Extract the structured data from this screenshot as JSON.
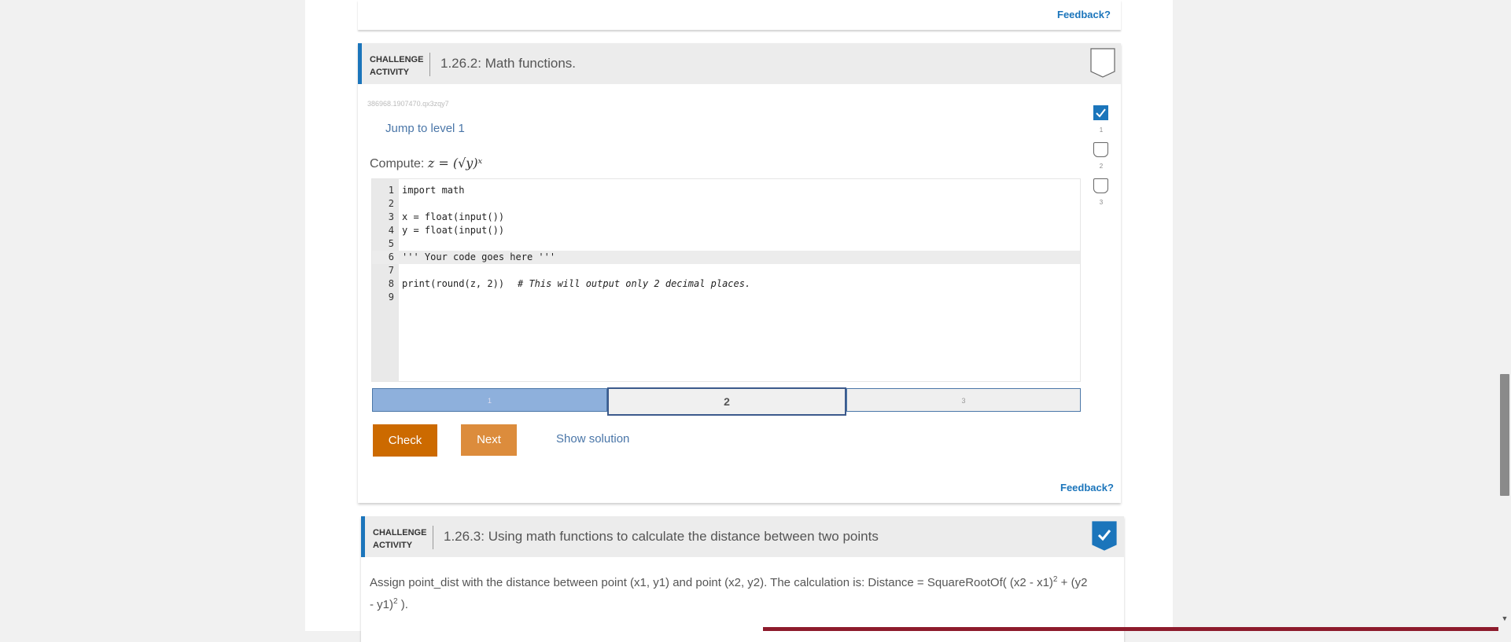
{
  "prev_card": {
    "feedback": "Feedback?"
  },
  "activity": {
    "badge_line1": "CHALLENGE",
    "badge_line2": "ACTIVITY",
    "title": "1.26.2: Math functions.",
    "id": "386968.1907470.qx3zqy7",
    "jump": "Jump to level 1",
    "compute_label": "Compute:",
    "compute_formula": "z = (√y)ˣ",
    "code": [
      {
        "n": "1",
        "t": "import math"
      },
      {
        "n": "2",
        "t": ""
      },
      {
        "n": "3",
        "t": "x = float(input())"
      },
      {
        "n": "4",
        "t": "y = float(input())"
      },
      {
        "n": "5",
        "t": ""
      },
      {
        "n": "6",
        "t": "''' Your code goes here '''"
      },
      {
        "n": "7",
        "t": ""
      },
      {
        "n": "8",
        "t": "print(round(z, 2))",
        "comment": "# This will output only 2 decimal places."
      },
      {
        "n": "9",
        "t": ""
      }
    ],
    "levels": [
      "1",
      "2",
      "3"
    ],
    "current_level": 2,
    "level_checks": [
      {
        "num": "1",
        "checked": true
      },
      {
        "num": "2",
        "checked": false
      },
      {
        "num": "3",
        "checked": false
      }
    ],
    "check_label": "Check",
    "next_label": "Next",
    "show_solution": "Show solution",
    "feedback": "Feedback?"
  },
  "next_activity": {
    "badge_line1": "CHALLENGE",
    "badge_line2": "ACTIVITY",
    "title": "1.26.3: Using math functions to calculate the distance between two points",
    "desc_part1": "Assign point_dist with the distance between point (x1, y1) and point (x2, y2). The calculation is: Distance = SquareRootOf( (x2 - x1)",
    "desc_sup1": "2",
    "desc_part2": " + (y2 - y1)",
    "desc_sup2": "2",
    "desc_part3": " )."
  },
  "colors": {
    "accent": "#1b75bb",
    "check_btn": "#cc6a00",
    "next_btn": "#dc8c3c"
  }
}
